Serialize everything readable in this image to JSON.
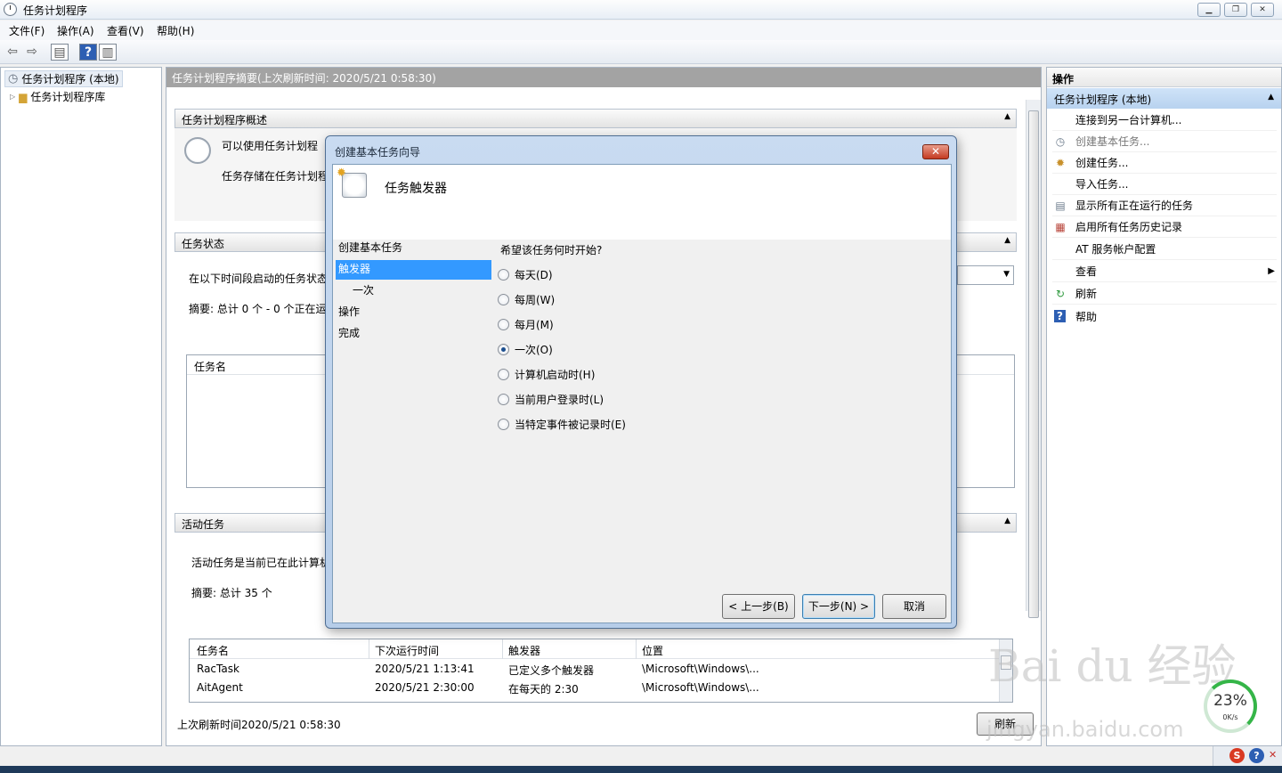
{
  "window": {
    "title": "任务计划程序"
  },
  "menubar": [
    "文件(F)",
    "操作(A)",
    "查看(V)",
    "帮助(H)"
  ],
  "tree": {
    "items": [
      "任务计划程序 (本地)",
      "任务计划程序库"
    ]
  },
  "center": {
    "header": "任务计划程序摘要(上次刷新时间: 2020/5/21 0:58:30)",
    "overview": {
      "title": "任务计划程序概述",
      "line1": "可以使用任务计划程",
      "line2": "任务存储在任务计划程"
    },
    "status": {
      "title": "任务状态",
      "line1": "在以下时间段启动的任务状态",
      "line2": "摘要: 总计 0 个 - 0 个正在运",
      "col": "任务名"
    },
    "active": {
      "title": "活动任务",
      "line1": "活动任务是当前已在此计算机",
      "line2": "摘要: 总计 35 个",
      "columns": [
        "任务名",
        "下次运行时间",
        "触发器",
        "位置"
      ],
      "rows": [
        [
          "RacTask",
          "2020/5/21 1:13:41",
          "已定义多个触发器",
          "\\Microsoft\\Windows\\..."
        ],
        [
          "AitAgent",
          "2020/5/21 2:30:00",
          "在每天的 2:30",
          "\\Microsoft\\Windows\\..."
        ]
      ]
    },
    "footer": "上次刷新时间2020/5/21 0:58:30",
    "refresh": "刷新"
  },
  "actions": {
    "title": "操作",
    "subtitle": "任务计划程序 (本地)",
    "items": [
      {
        "label": "连接到另一台计算机...",
        "icon": ""
      },
      {
        "label": "创建基本任务...",
        "icon": "clock-icon"
      },
      {
        "label": "创建任务...",
        "icon": "task-icon"
      },
      {
        "label": "导入任务...",
        "icon": ""
      },
      {
        "label": "显示所有正在运行的任务",
        "icon": "list-icon"
      },
      {
        "label": "启用所有任务历史记录",
        "icon": "history-icon"
      },
      {
        "label": "AT 服务帐户配置",
        "icon": ""
      },
      {
        "label": "查看",
        "icon": ""
      },
      {
        "label": "刷新",
        "icon": "refresh-icon"
      },
      {
        "label": "帮助",
        "icon": "help-icon"
      }
    ]
  },
  "dialog": {
    "title": "创建基本任务向导",
    "heading": "任务触发器",
    "nav": [
      "创建基本任务",
      "触发器",
      "一次",
      "操作",
      "完成"
    ],
    "question": "希望该任务何时开始?",
    "options": [
      "每天(D)",
      "每周(W)",
      "每月(M)",
      "一次(O)",
      "计算机启动时(H)",
      "当前用户登录时(L)",
      "当特定事件被记录时(E)"
    ],
    "selected_option": "一次(O)",
    "buttons": {
      "back": "< 上一步(B)",
      "next": "下一步(N) >",
      "cancel": "取消"
    }
  },
  "gauge": {
    "percent": "23%",
    "speed": "0K/s"
  },
  "watermark": {
    "main": "Bai du 经验",
    "sub": "jingyan.baidu.com"
  }
}
